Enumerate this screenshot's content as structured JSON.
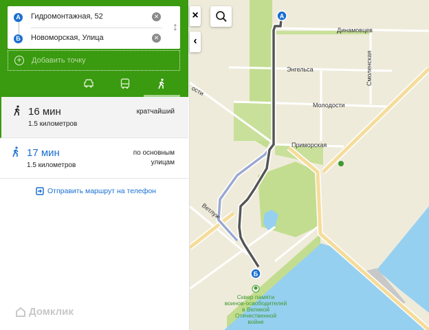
{
  "route_form": {
    "point_a": {
      "badge": "А",
      "value": "Гидромонтажная, 52"
    },
    "point_b": {
      "badge": "Б",
      "value": "Новоморская, Улица"
    },
    "add_point_label": "Добавить точку"
  },
  "modes": [
    {
      "icon": "car-icon"
    },
    {
      "icon": "bus-icon"
    },
    {
      "icon": "walk-icon",
      "active": true
    }
  ],
  "routes": [
    {
      "time": "16 мин",
      "distance": "1.5 километров",
      "tag": "кратчайший",
      "selected": true
    },
    {
      "time": "17 мин",
      "distance": "1.5 километров",
      "tag": "по основным улицам",
      "selected": false
    }
  ],
  "send_to_phone": "Отправить маршрут на телефон",
  "brand": "Домклик",
  "map": {
    "close_label": "×",
    "collapse_label": "‹",
    "streets": {
      "dinamovtsev": "Динамовцев",
      "engelsa": "Энгельса",
      "smolenskaya": "Смоленская",
      "molodosti": "Молодости",
      "molodosti2": "ости",
      "primorskaya": "Приморская",
      "vetluzh": "Ветлуж"
    },
    "poi": "Сквер памяти воинов-освободителей в Великой Отечественной войне",
    "poi_lines": [
      "Сквер памяти",
      "воинов-освободителей",
      "в Великой",
      "Отечественной",
      "войне"
    ],
    "marker_a": "А",
    "marker_b": "Б"
  },
  "colors": {
    "accent": "#3a9a10",
    "link": "#1a6fd0",
    "water": "#96d0f0",
    "park": "#c2dd8f"
  }
}
